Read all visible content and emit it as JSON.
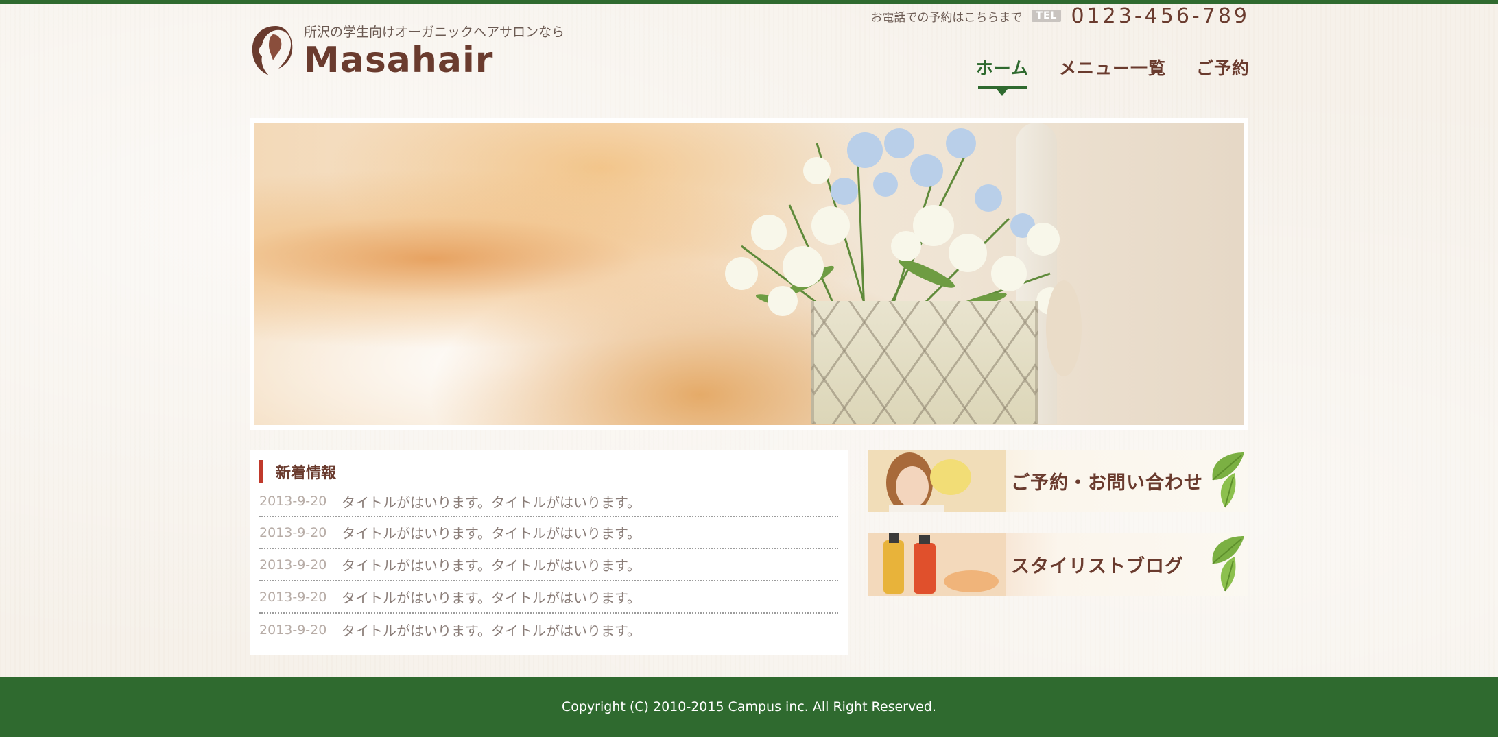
{
  "brand": {
    "tagline": "所沢の学生向けオーガニックヘアサロンなら",
    "name": "Masahair"
  },
  "contact": {
    "caption": "お電話での予約はこちらまで",
    "badge": "TEL",
    "number": "0123-456-789"
  },
  "nav": {
    "items": [
      {
        "label": "ホーム",
        "active": true
      },
      {
        "label": "メニュー一覧",
        "active": false
      },
      {
        "label": "ご予約",
        "active": false
      }
    ]
  },
  "news": {
    "title": "新着情報",
    "items": [
      {
        "date": "2013-9-20",
        "text": "タイトルがはいります。タイトルがはいります。"
      },
      {
        "date": "2013-9-20",
        "text": "タイトルがはいります。タイトルがはいります。"
      },
      {
        "date": "2013-9-20",
        "text": "タイトルがはいります。タイトルがはいります。"
      },
      {
        "date": "2013-9-20",
        "text": "タイトルがはいります。タイトルがはいります。"
      },
      {
        "date": "2013-9-20",
        "text": "タイトルがはいります。タイトルがはいります。"
      }
    ]
  },
  "banners": {
    "reservation": "ご予約・お問い合わせ",
    "blog": "スタイリストブログ"
  },
  "footer": {
    "copyright": "Copyright (C) 2010-2015 Campus inc. All Right Reserved."
  },
  "colors": {
    "brand_green": "#2f6a2f",
    "brand_brown": "#6a3b2e",
    "accent_red": "#c0392b"
  }
}
